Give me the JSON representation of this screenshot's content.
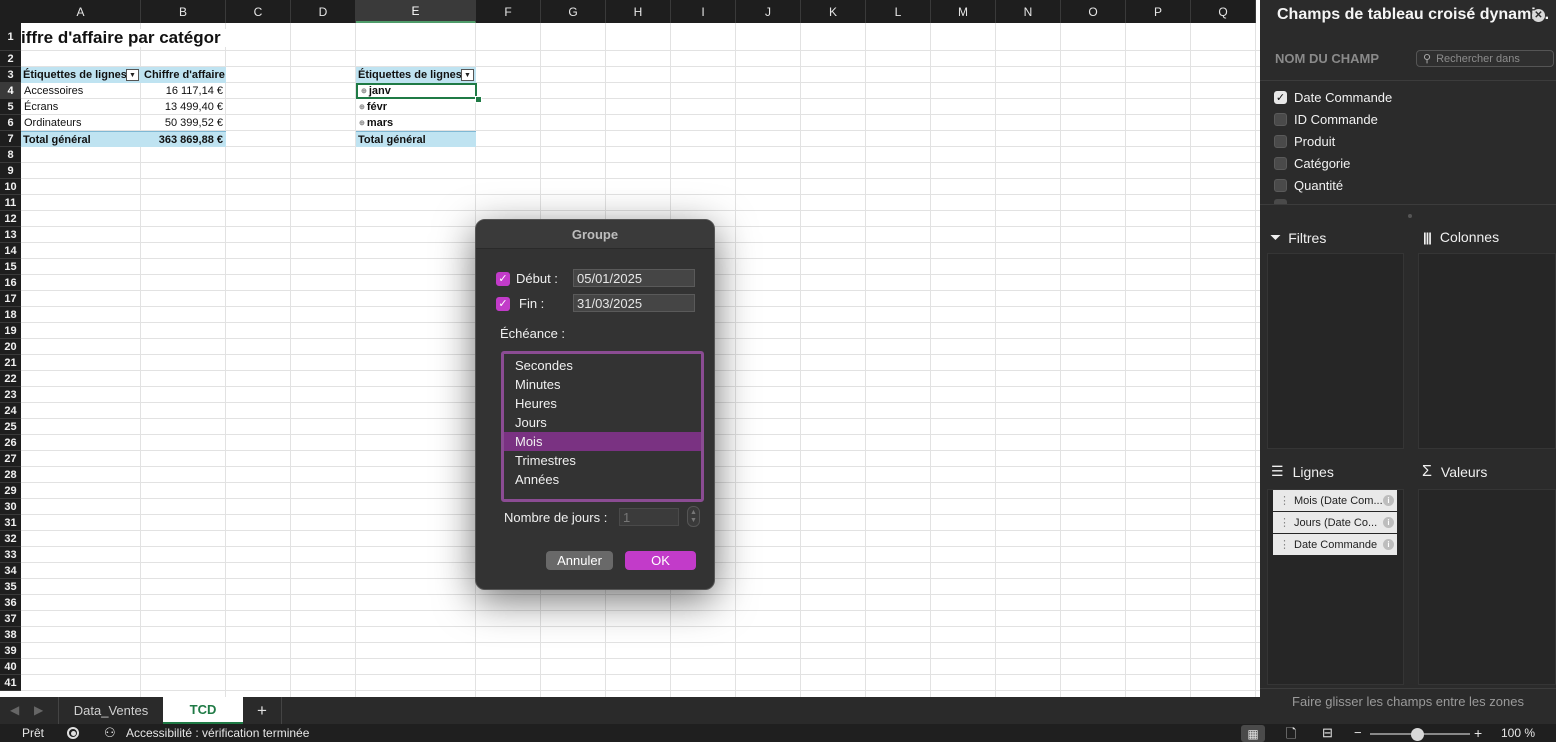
{
  "sheet": {
    "columns": [
      "A",
      "B",
      "C",
      "D",
      "E",
      "F",
      "G",
      "H",
      "I",
      "J",
      "K",
      "L",
      "M",
      "N",
      "O",
      "P",
      "Q"
    ],
    "rows": [
      "1",
      "2",
      "3",
      "4",
      "5",
      "6",
      "7",
      "8",
      "9",
      "10",
      "11",
      "12",
      "13",
      "14",
      "15",
      "16",
      "17",
      "18",
      "19",
      "20",
      "21",
      "22",
      "23",
      "24",
      "25",
      "26",
      "27",
      "28",
      "29",
      "30",
      "31",
      "32",
      "33",
      "34",
      "35",
      "36",
      "37",
      "38",
      "39",
      "40",
      "41"
    ],
    "selected_cell": "E4",
    "title": "iffre d'affaire par catégor",
    "pivot1": {
      "header_rows": "Étiquettes de lignes",
      "header_values": "Chiffre d'affaire",
      "rows": [
        {
          "label": "Accessoires",
          "value": "16 117,14 €"
        },
        {
          "label": "Écrans",
          "value": "13 499,40 €"
        },
        {
          "label": "Ordinateurs",
          "value": "50 399,52 €"
        }
      ],
      "total_label": "Total général",
      "total_value": "363 869,88 €"
    },
    "pivot2": {
      "header_rows": "Étiquettes de lignes",
      "rows": [
        "janv",
        "févr",
        "mars"
      ],
      "expand_glyph": "⊕",
      "total_label": "Total général"
    }
  },
  "tabs": {
    "items": [
      {
        "label": "Data_Ventes",
        "active": false
      },
      {
        "label": "TCD",
        "active": true
      }
    ],
    "add_label": "+"
  },
  "status": {
    "ready": "Prêt",
    "accessibility": "Accessibilité : vérification terminée",
    "zoom_minus": "−",
    "zoom_plus": "+",
    "zoom": "100 %"
  },
  "panel": {
    "title": "Champs de tableau croisé dynami...",
    "field_name_label": "NOM DU CHAMP",
    "search_placeholder": "Rechercher dans",
    "fields": [
      {
        "label": "Date Commande",
        "checked": true
      },
      {
        "label": "ID Commande",
        "checked": false
      },
      {
        "label": "Produit",
        "checked": false
      },
      {
        "label": "Catégorie",
        "checked": false
      },
      {
        "label": "Quantité",
        "checked": false
      }
    ],
    "zones": {
      "filters": "Filtres",
      "columns": "Colonnes",
      "rows": "Lignes",
      "values": "Valeurs"
    },
    "row_chips": [
      "Mois (Date Com...",
      "Jours (Date Co...",
      "Date Commande"
    ],
    "chip_info": "i",
    "footer": "Faire glisser les champs entre les zones"
  },
  "dialog": {
    "title": "Groupe",
    "start_label": "Début :",
    "start_value": "05/01/2025",
    "end_label": "Fin :",
    "end_value": "31/03/2025",
    "echeance_label": "Échéance :",
    "list": [
      "Secondes",
      "Minutes",
      "Heures",
      "Jours",
      "Mois",
      "Trimestres",
      "Années"
    ],
    "selected": "Mois",
    "days_label": "Nombre de jours :",
    "days_value": "1",
    "cancel": "Annuler",
    "ok": "OK",
    "accent": "#c23bc9"
  }
}
